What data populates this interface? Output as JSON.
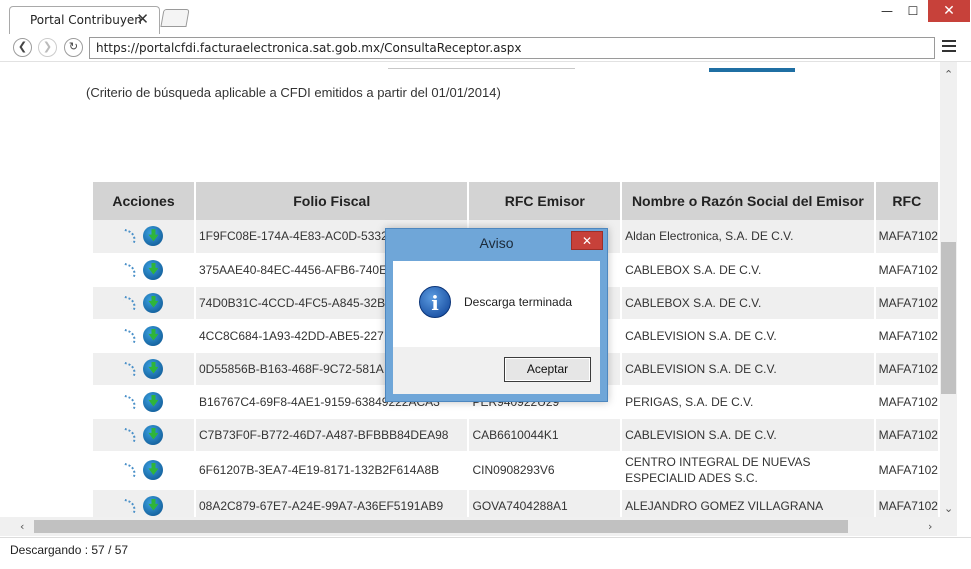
{
  "browser": {
    "tab_title": "Portal Contribuyen",
    "tab_close": "✕",
    "url": "https://portalcfdi.facturaelectronica.sat.gob.mx/ConsultaReceptor.aspx",
    "win_min": "—",
    "win_max": "☐",
    "win_close": "✕"
  },
  "page": {
    "criteria": "(Criterio de búsqueda aplicable a CFDI emitidos a partir del 01/01/2014)"
  },
  "table": {
    "headers": [
      "Acciones",
      "Folio Fiscal",
      "RFC Emisor",
      "Nombre o Razón Social del Emisor",
      "RFC"
    ],
    "rows": [
      {
        "folio": "1F9FC08E-174A-4E83-AC0D-5332",
        "rfc": "",
        "nombre": "Aldan Electronica, S.A. DE C.V.",
        "rfc2": "MAFA7102"
      },
      {
        "folio": "375AAE40-84EC-4456-AFB6-740E",
        "rfc": "",
        "nombre": "CABLEBOX S.A. DE C.V.",
        "rfc2": "MAFA7102"
      },
      {
        "folio": "74D0B31C-4CCD-4FC5-A845-32B",
        "rfc": "",
        "nombre": "CABLEBOX S.A. DE C.V.",
        "rfc2": "MAFA7102"
      },
      {
        "folio": "4CC8C684-1A93-42DD-ABE5-227",
        "rfc": "",
        "nombre": "CABLEVISION S.A. DE C.V.",
        "rfc2": "MAFA7102"
      },
      {
        "folio": "0D55856B-B163-468F-9C72-581A",
        "rfc": "",
        "nombre": "CABLEVISION S.A. DE C.V.",
        "rfc2": "MAFA7102"
      },
      {
        "folio": "B16767C4-69F8-4AE1-9159-63849222ACA3",
        "rfc": "PER940922U29",
        "nombre": "PERIGAS, S.A. DE C.V.",
        "rfc2": "MAFA7102"
      },
      {
        "folio": "C7B73F0F-B772-46D7-A487-BFBBB84DEA98",
        "rfc": "CAB6610044K1",
        "nombre": "CABLEVISION S.A. DE C.V.",
        "rfc2": "MAFA7102"
      },
      {
        "folio": "6F61207B-3EA7-4E19-8171-132B2F614A8B",
        "rfc": "CIN0908293V6",
        "nombre": "CENTRO INTEGRAL DE NUEVAS ESPECIALID ADES S.C.",
        "rfc2": "MAFA7102"
      },
      {
        "folio": "08A2C879-67E7-A24E-99A7-A36EF5191AB9",
        "rfc": "GOVA7404288A1",
        "nombre": "ALEJANDRO GOMEZ VILLAGRANA",
        "rfc2": "MAFA7102"
      }
    ]
  },
  "status": {
    "text": "Descargando : 57 / 57"
  },
  "dialog": {
    "title": "Aviso",
    "close": "✕",
    "message": "Descarga terminada",
    "button": "Aceptar",
    "icon_letter": "i"
  },
  "colors": {
    "close_red": "#c7413a",
    "dialog_blue": "#6fa6d8",
    "header_gray": "#d3d3d3",
    "accent_blue": "#1f6fa3"
  }
}
